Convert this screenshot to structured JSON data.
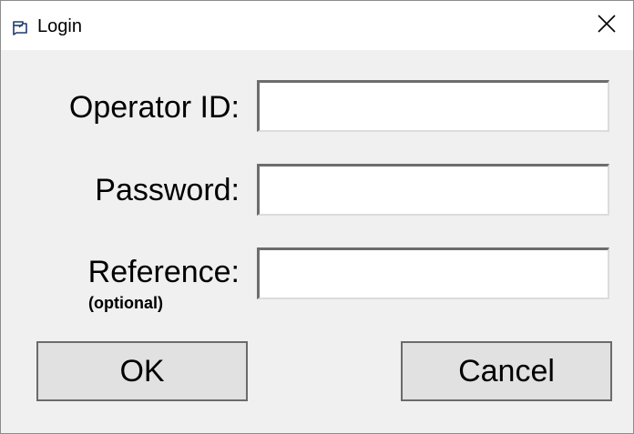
{
  "window": {
    "title": "Login",
    "app_icon": "dialog-window-icon",
    "close_icon": "close-icon"
  },
  "form": {
    "operator_id": {
      "label": "Operator ID:",
      "value": ""
    },
    "password": {
      "label": "Password:",
      "value": ""
    },
    "reference": {
      "label": "Reference:",
      "hint": "(optional)",
      "value": ""
    }
  },
  "buttons": {
    "ok_label": "OK",
    "cancel_label": "Cancel"
  },
  "colors": {
    "dialog_background": "#f0f0f0",
    "titlebar_background": "#ffffff",
    "field_background": "#ffffff",
    "button_face": "#e1e1e1"
  }
}
